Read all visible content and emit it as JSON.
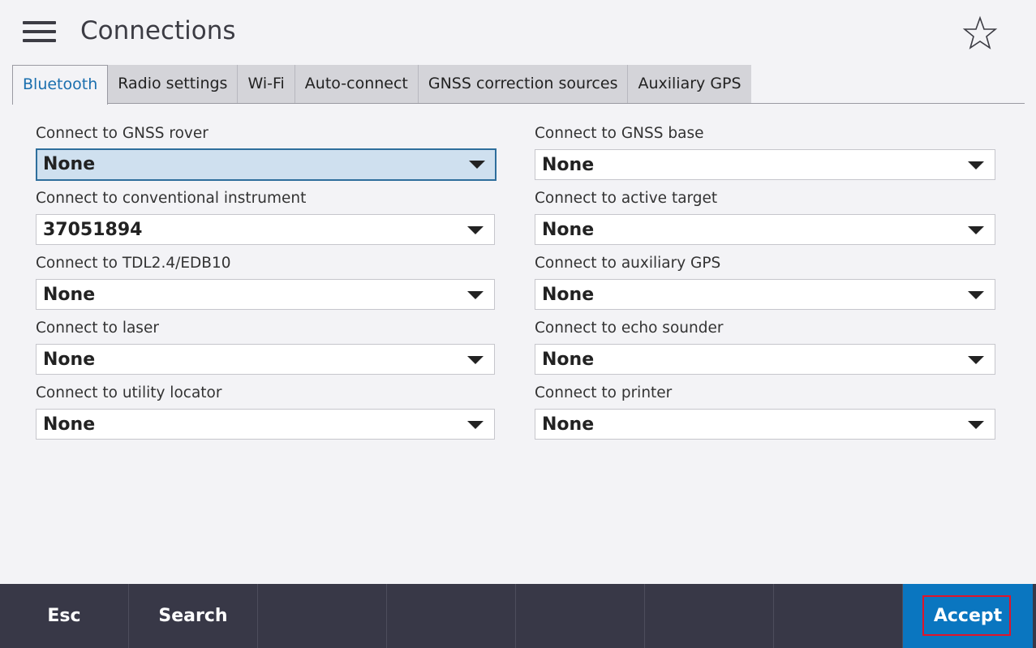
{
  "header": {
    "title": "Connections",
    "menu_icon": "hamburger-menu-icon",
    "favorite_icon": "star-icon"
  },
  "tabs": [
    {
      "label": "Bluetooth",
      "active": true
    },
    {
      "label": "Radio settings",
      "active": false
    },
    {
      "label": "Wi-Fi",
      "active": false
    },
    {
      "label": "Auto-connect",
      "active": false
    },
    {
      "label": "GNSS correction sources",
      "active": false
    },
    {
      "label": "Auxiliary GPS",
      "active": false
    }
  ],
  "fields": {
    "gnss_rover": {
      "label": "Connect to GNSS rover",
      "value": "None"
    },
    "conventional_instrument": {
      "label": "Connect to conventional instrument",
      "value": "37051894"
    },
    "tdl": {
      "label": "Connect to TDL2.4/EDB10",
      "value": "None"
    },
    "laser": {
      "label": "Connect to laser",
      "value": "None"
    },
    "utility_locator": {
      "label": "Connect to utility locator",
      "value": "None"
    },
    "gnss_base": {
      "label": "Connect to GNSS base",
      "value": "None"
    },
    "active_target": {
      "label": "Connect to active target",
      "value": "None"
    },
    "auxiliary_gps": {
      "label": "Connect to auxiliary GPS",
      "value": "None"
    },
    "echo_sounder": {
      "label": "Connect to echo sounder",
      "value": "None"
    },
    "printer": {
      "label": "Connect to printer",
      "value": "None"
    }
  },
  "softkeys": {
    "esc": "Esc",
    "search": "Search",
    "accept": "Accept"
  },
  "colors": {
    "accent": "#0a76c0",
    "bottom_bar": "#383847",
    "active_tab_text": "#1a6fae",
    "focus_fill": "#cfe0ef",
    "highlight": "#e0142a"
  }
}
